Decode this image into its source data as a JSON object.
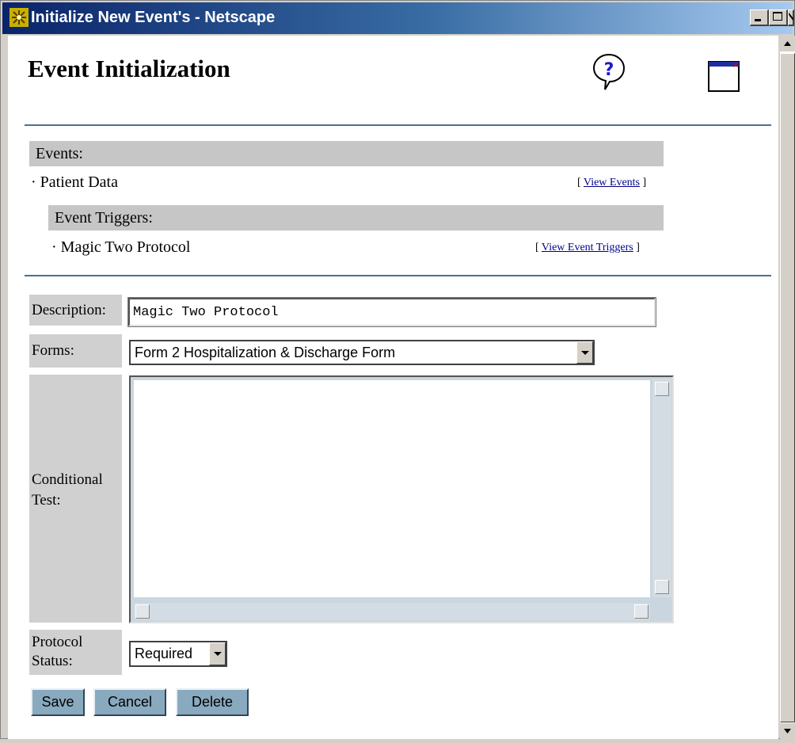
{
  "window": {
    "title": "Initialize New Event's - Netscape",
    "controls": [
      "minimize-icon",
      "maximize-icon",
      "close-icon"
    ]
  },
  "page": {
    "title": "Event Initialization",
    "help_icon": "help-balloon-icon",
    "close_window_icon": "close-window-icon"
  },
  "events": {
    "header": "Events:",
    "item": "Patient Data",
    "link_open": "[",
    "link_label": "View Events",
    "link_close": "]"
  },
  "triggers": {
    "header": "Event Triggers:",
    "item": "Magic Two Protocol",
    "link_open": "[",
    "link_label": "View Event Triggers",
    "link_close": "]"
  },
  "form": {
    "description_label": "Description:",
    "description_value": "Magic Two Protocol",
    "forms_label": "Forms:",
    "forms_selected": "Form 2 Hospitalization & Discharge Form",
    "conditional_label_line1": "Conditional",
    "conditional_label_line2": "Test:",
    "conditional_value": "",
    "protocol_label_line1": "Protocol",
    "protocol_label_line2": "Status:",
    "protocol_selected": "Required"
  },
  "buttons": {
    "save": "Save",
    "cancel": "Cancel",
    "delete": "Delete"
  },
  "colors": {
    "titlebar_start": "#0a246a",
    "titlebar_end": "#a6caf0",
    "band_gray": "#c6c6c6",
    "button_blue": "#89a9bf",
    "rule_blue": "#4a7090",
    "link_blue": "#00008b"
  }
}
